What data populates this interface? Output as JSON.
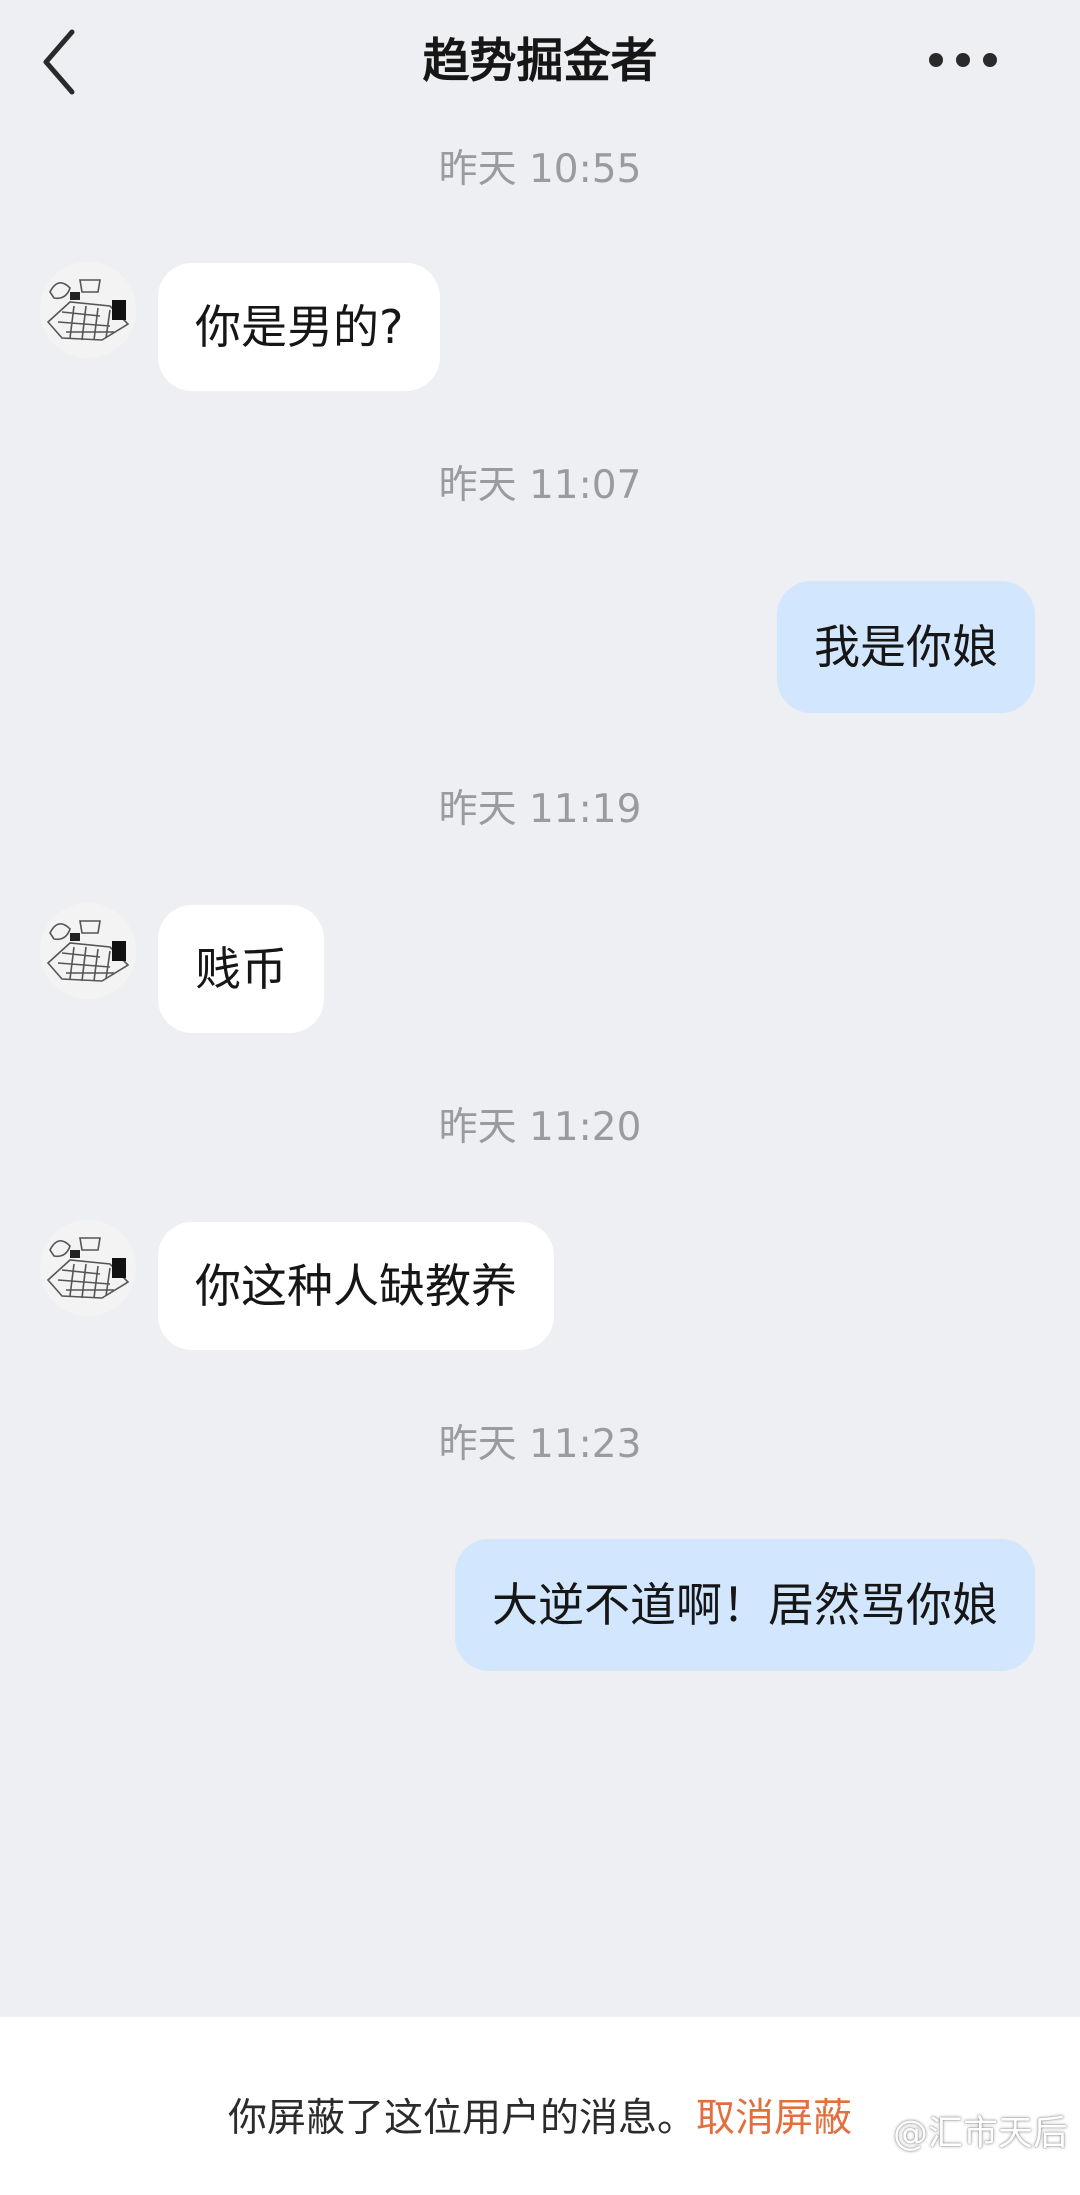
{
  "header": {
    "title": "趋势掘金者",
    "back_icon": "chevron-left-icon",
    "more_icon": "more-dots-icon"
  },
  "messages": [
    {
      "time": "昨天 10:55",
      "direction": "in",
      "text": "你是男的?"
    },
    {
      "time": "昨天 11:07",
      "direction": "out",
      "text": "我是你娘"
    },
    {
      "time": "昨天 11:19",
      "direction": "in",
      "text": "贱币"
    },
    {
      "time": "昨天 11:20",
      "direction": "in",
      "text": "你这种人缺教养"
    },
    {
      "time": "昨天 11:23",
      "direction": "out",
      "text": "大逆不道啊！居然骂你娘"
    }
  ],
  "footer": {
    "blocked_text": "你屏蔽了这位用户的消息。",
    "unblock_label": "取消屏蔽",
    "watermark": "@汇市天后"
  },
  "colors": {
    "background": "#eeeff2",
    "incoming_bubble": "#ffffff",
    "outgoing_bubble": "#d2e6fd",
    "link_accent": "#e2703f",
    "timestamp": "#9a9b9f"
  }
}
